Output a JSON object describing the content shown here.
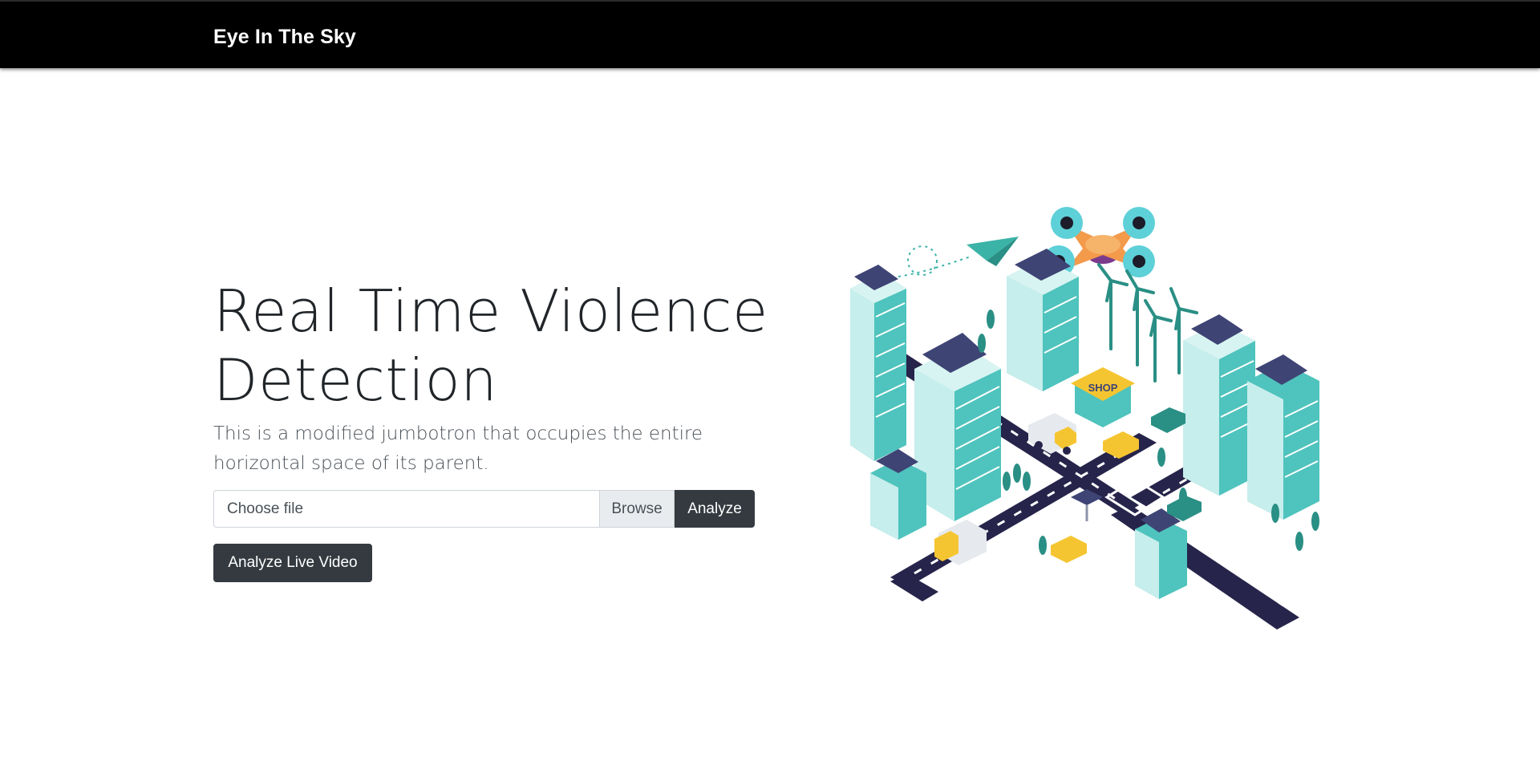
{
  "navbar": {
    "brand": "Eye In The Sky"
  },
  "hero": {
    "title": "Real Time Violence Detection",
    "lead": "This is a modified jumbotron that occupies the entire horizontal space of its parent."
  },
  "upload": {
    "placeholder": "Choose file",
    "browse_label": "Browse",
    "analyze_label": "Analyze"
  },
  "live": {
    "button_label": "Analyze Live Video"
  },
  "illustration": {
    "shop_sign": "SHOP"
  },
  "colors": {
    "navbar_bg": "#000000",
    "button_dark": "#343a40",
    "building_teal": "#4fc3bd",
    "road_navy": "#26244a",
    "taxi_yellow": "#f5c531",
    "drone_orange": "#f39a4b"
  }
}
